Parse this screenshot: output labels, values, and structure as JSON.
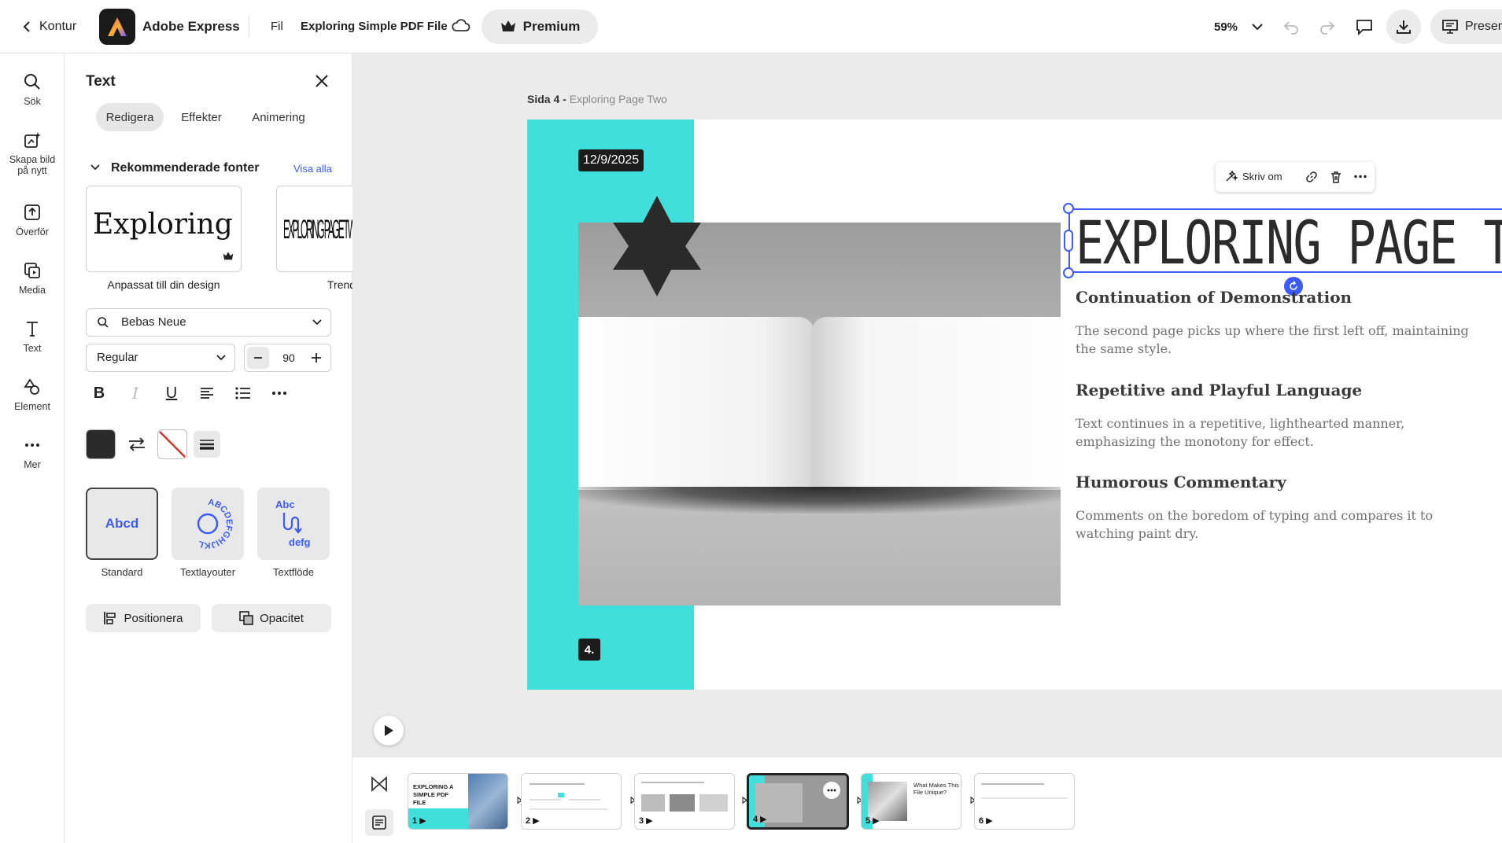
{
  "topbar": {
    "back_label": "Kontur",
    "app_name": "Adobe Express",
    "file_menu": "Fil",
    "doc_title": "Exploring Simple PDF File",
    "premium_label": "Premium",
    "zoom": "59%",
    "present_label": "Presentera"
  },
  "rail": {
    "items": [
      {
        "label": "Sök"
      },
      {
        "label": "Skapa bild på nytt"
      },
      {
        "label": "Överför"
      },
      {
        "label": "Media"
      },
      {
        "label": "Text"
      },
      {
        "label": "Element"
      },
      {
        "label": "Mer"
      }
    ]
  },
  "panel": {
    "title": "Text",
    "tabs": [
      "Redigera",
      "Effekter",
      "Animering"
    ],
    "section_title": "Rekommenderade fonter",
    "see_all": "Visa alla",
    "font_cards": [
      {
        "preview": "Exploring Pag",
        "caption": "Anpassat till din design"
      },
      {
        "preview": "EXPLORING PAGE TWO",
        "caption": "Trender"
      }
    ],
    "font_family": "Bebas Neue",
    "font_weight": "Regular",
    "font_size": "90",
    "text_styles": [
      {
        "preview": "Abcd",
        "label": "Standard"
      },
      {
        "preview": "ABCDEFGHIJKL",
        "label": "Textlayouter"
      },
      {
        "preview_top": "Abc",
        "preview_bottom": "defg",
        "label": "Textflöde"
      }
    ],
    "position_button": "Positionera",
    "opacity_button": "Opacitet",
    "colors": {
      "text_color": "#2b2b2b",
      "accent": "#3d5afe"
    }
  },
  "canvas": {
    "page_label_bold": "Sida 4 - ",
    "page_label_rest": "Exploring Page Two",
    "slide": {
      "date": "12/9/2025",
      "page_number": "4.",
      "title": "EXPLORING PAGE TWO",
      "sections": [
        {
          "heading": "Continuation of Demonstration",
          "body_lines": [
            "The second page picks up where the first left off, maintaining",
            "the same style."
          ]
        },
        {
          "heading": "Repetitive and Playful Language",
          "body_lines": [
            "Text continues in a repetitive, lighthearted manner,",
            "emphasizing the monotony for effect."
          ]
        },
        {
          "heading": "Humorous Commentary",
          "body_lines": [
            "Comments on the boredom of typing and compares it to",
            "watching paint dry."
          ]
        }
      ],
      "colors": {
        "teal": "#40dfdc",
        "selection": "#3d5afe"
      }
    },
    "floating_toolbar": {
      "rewrite_label": "Skriv om"
    }
  },
  "filmstrip": {
    "thumbnails": [
      {
        "number": "1",
        "title": "EXPLORING A SIMPLE PDF FILE"
      },
      {
        "number": "2"
      },
      {
        "number": "3"
      },
      {
        "number": "4"
      },
      {
        "number": "5",
        "title": "What Makes This File Unique?"
      },
      {
        "number": "6"
      }
    ]
  }
}
